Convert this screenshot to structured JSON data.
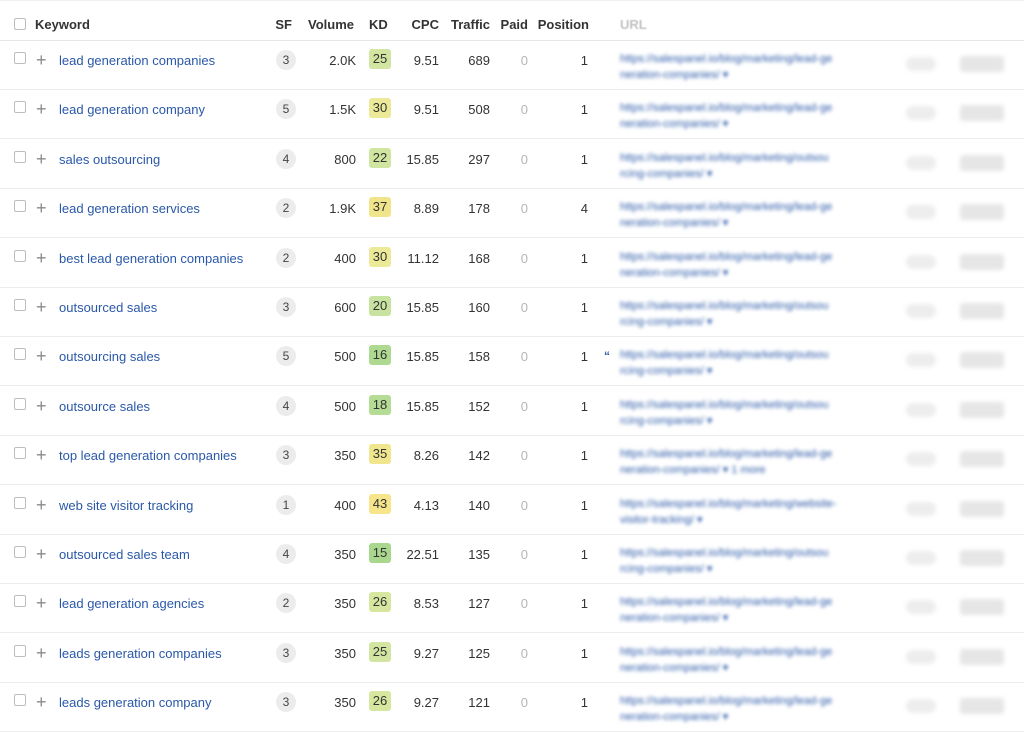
{
  "header": {
    "keyword": "Keyword",
    "sf": "SF",
    "volume": "Volume",
    "kd": "KD",
    "cpc": "CPC",
    "traffic": "Traffic",
    "paid": "Paid",
    "position": "Position",
    "url": "URL"
  },
  "kd_colors": {
    "easy_green": "#aad88f",
    "medium_green": "#cfe39f",
    "yellow": "#f3e78a"
  },
  "rows": [
    {
      "keyword": "lead generation companies",
      "sf": "3",
      "volume": "2.0K",
      "kd": "25",
      "kd_color": "#d3e6a1",
      "cpc": "9.51",
      "traffic": "689",
      "paid": "0",
      "position": "1",
      "url_line1": "https://salespanel.io/blog/marketing/lead-ge",
      "url_line2": "neration-companies/ ▾"
    },
    {
      "keyword": "lead generation company",
      "sf": "5",
      "volume": "1.5K",
      "kd": "30",
      "kd_color": "#ecea99",
      "cpc": "9.51",
      "traffic": "508",
      "paid": "0",
      "position": "1",
      "url_line1": "https://salespanel.io/blog/marketing/lead-ge",
      "url_line2": "neration-companies/ ▾"
    },
    {
      "keyword": "sales outsourcing",
      "sf": "4",
      "volume": "800",
      "kd": "22",
      "kd_color": "#cfe5a0",
      "cpc": "15.85",
      "traffic": "297",
      "paid": "0",
      "position": "1",
      "url_line1": "https://salespanel.io/blog/marketing/outsou",
      "url_line2": "rcing-companies/ ▾"
    },
    {
      "keyword": "lead generation services",
      "sf": "2",
      "volume": "1.9K",
      "kd": "37",
      "kd_color": "#f1e58c",
      "cpc": "8.89",
      "traffic": "178",
      "paid": "0",
      "position": "4",
      "url_line1": "https://salespanel.io/blog/marketing/lead-ge",
      "url_line2": "neration-companies/ ▾"
    },
    {
      "keyword": "best lead generation companies",
      "sf": "2",
      "volume": "400",
      "kd": "30",
      "kd_color": "#ecea99",
      "cpc": "11.12",
      "traffic": "168",
      "paid": "0",
      "position": "1",
      "url_line1": "https://salespanel.io/blog/marketing/lead-ge",
      "url_line2": "neration-companies/ ▾"
    },
    {
      "keyword": "outsourced sales",
      "sf": "3",
      "volume": "600",
      "kd": "20",
      "kd_color": "#c8e3a0",
      "cpc": "15.85",
      "traffic": "160",
      "paid": "0",
      "position": "1",
      "url_line1": "https://salespanel.io/blog/marketing/outsou",
      "url_line2": "rcing-companies/ ▾"
    },
    {
      "keyword": "outsourcing sales",
      "sf": "5",
      "volume": "500",
      "kd": "16",
      "kd_color": "#aed991",
      "cpc": "15.85",
      "traffic": "158",
      "paid": "0",
      "position": "1",
      "quote": "“",
      "url_line1": "https://salespanel.io/blog/marketing/outsou",
      "url_line2": "rcing-companies/ ▾"
    },
    {
      "keyword": "outsource sales",
      "sf": "4",
      "volume": "500",
      "kd": "18",
      "kd_color": "#b5dc95",
      "cpc": "15.85",
      "traffic": "152",
      "paid": "0",
      "position": "1",
      "url_line1": "https://salespanel.io/blog/marketing/outsou",
      "url_line2": "rcing-companies/ ▾"
    },
    {
      "keyword": "top lead generation companies",
      "sf": "3",
      "volume": "350",
      "kd": "35",
      "kd_color": "#f0e68e",
      "cpc": "8.26",
      "traffic": "142",
      "paid": "0",
      "position": "1",
      "url_line1": "https://salespanel.io/blog/marketing/lead-ge",
      "url_line2": "neration-companies/ ▾  1 more"
    },
    {
      "keyword": "web site visitor tracking",
      "sf": "1",
      "volume": "400",
      "kd": "43",
      "kd_color": "#f6e58a",
      "cpc": "4.13",
      "traffic": "140",
      "paid": "0",
      "position": "1",
      "url_line1": "https://salespanel.io/blog/marketing/website-",
      "url_line2": "visitor-tracking/ ▾"
    },
    {
      "keyword": "outsourced sales team",
      "sf": "4",
      "volume": "350",
      "kd": "15",
      "kd_color": "#a9d78e",
      "cpc": "22.51",
      "traffic": "135",
      "paid": "0",
      "position": "1",
      "url_line1": "https://salespanel.io/blog/marketing/outsou",
      "url_line2": "rcing-companies/ ▾"
    },
    {
      "keyword": "lead generation agencies",
      "sf": "2",
      "volume": "350",
      "kd": "26",
      "kd_color": "#d7e7a0",
      "cpc": "8.53",
      "traffic": "127",
      "paid": "0",
      "position": "1",
      "url_line1": "https://salespanel.io/blog/marketing/lead-ge",
      "url_line2": "neration-companies/ ▾"
    },
    {
      "keyword": "leads generation companies",
      "sf": "3",
      "volume": "350",
      "kd": "25",
      "kd_color": "#d3e6a1",
      "cpc": "9.27",
      "traffic": "125",
      "paid": "0",
      "position": "1",
      "url_line1": "https://salespanel.io/blog/marketing/lead-ge",
      "url_line2": "neration-companies/ ▾"
    },
    {
      "keyword": "leads generation company",
      "sf": "3",
      "volume": "350",
      "kd": "26",
      "kd_color": "#d7e7a0",
      "cpc": "9.27",
      "traffic": "121",
      "paid": "0",
      "position": "1",
      "url_line1": "https://salespanel.io/blog/marketing/lead-ge",
      "url_line2": "neration-companies/ ▾"
    }
  ]
}
